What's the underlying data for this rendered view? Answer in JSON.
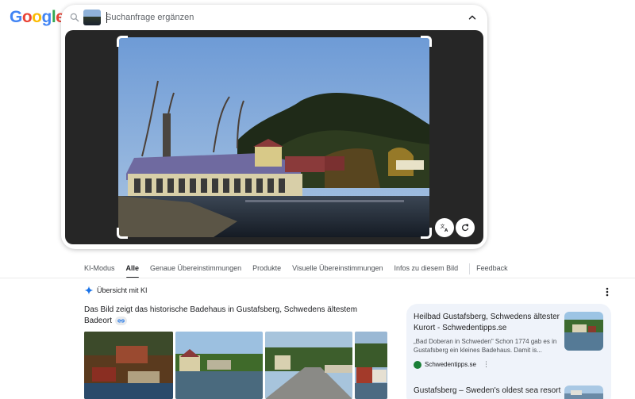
{
  "logo": {
    "letters": [
      {
        "ch": "G",
        "color": "#4285F4"
      },
      {
        "ch": "o",
        "color": "#EA4335"
      },
      {
        "ch": "o",
        "color": "#FBBC05"
      },
      {
        "ch": "g",
        "color": "#4285F4"
      },
      {
        "ch": "l",
        "color": "#34A853"
      },
      {
        "ch": "e",
        "color": "#EA4335"
      }
    ]
  },
  "search": {
    "placeholder": "Suchanfrage ergänzen",
    "value": ""
  },
  "icons": {
    "search": "search-icon",
    "collapse": "chevron-up-icon",
    "translate": "translate-icon",
    "reset": "refresh-icon",
    "ai": "sparkle-icon",
    "more": "more-vert-icon",
    "link": "link-icon"
  },
  "tabs": [
    {
      "label": "KI-Modus",
      "active": false
    },
    {
      "label": "Alle",
      "active": true
    },
    {
      "label": "Genaue Übereinstimmungen",
      "active": false
    },
    {
      "label": "Produkte",
      "active": false
    },
    {
      "label": "Visuelle Übereinstimmungen",
      "active": false
    },
    {
      "label": "Infos zu diesem Bild",
      "active": false
    },
    {
      "label": "Feedback",
      "active": false
    }
  ],
  "ai_overview": {
    "header": "Übersicht mit KI",
    "text": "Das Bild zeigt das historische Badehaus in Gustafsberg, Schwedens ältestem Badeort"
  },
  "results": [
    {
      "title": "Heilbad Gustafsberg, Schwedens ältester Kurort - Schwedentipps.se",
      "snippet": "„Bad Doberan in Schweden\" Schon 1774 gab es in Gustafsberg ein kleines Badehaus. Damit is...",
      "source": "Schwedentipps.se"
    },
    {
      "title": "Gustafsberg – Sweden's oldest sea resort"
    }
  ],
  "colors": {
    "accent": "#1a73e8",
    "panel": "#eff3fa",
    "viewer": "#262626"
  }
}
